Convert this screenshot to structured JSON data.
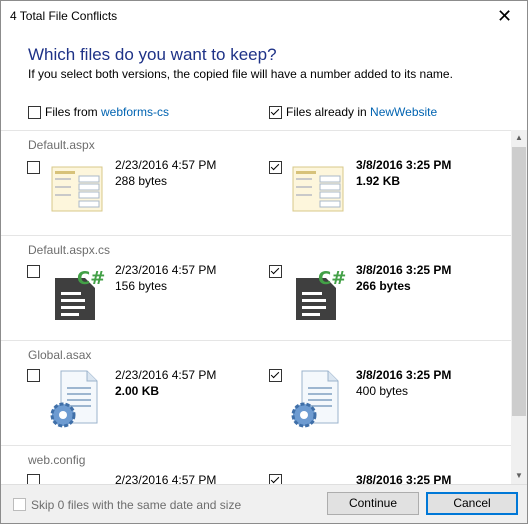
{
  "window": {
    "title": "4 Total File Conflicts",
    "close_glyph": "✕"
  },
  "heading": "Which files do you want to keep?",
  "subtext": "If you select both versions, the copied file will have a number added to its name.",
  "columns": {
    "left": {
      "prefix": "Files from ",
      "link": "webforms-cs",
      "checked": false
    },
    "right": {
      "prefix": "Files already in ",
      "link": "NewWebsite",
      "checked": true
    }
  },
  "files": [
    {
      "name": "Default.aspx",
      "icon": "aspx-form-icon",
      "left": {
        "date": "2/23/2016 4:57 PM",
        "size": "288 bytes",
        "checked": false,
        "bold": false
      },
      "right": {
        "date": "3/8/2016 3:25 PM",
        "size": "1.92 KB",
        "checked": true,
        "bold": true
      }
    },
    {
      "name": "Default.aspx.cs",
      "icon": "csharp-file-icon",
      "left": {
        "date": "2/23/2016 4:57 PM",
        "size": "156 bytes",
        "checked": false,
        "bold": false
      },
      "right": {
        "date": "3/8/2016 3:25 PM",
        "size": "266 bytes",
        "checked": true,
        "bold": true
      }
    },
    {
      "name": "Global.asax",
      "icon": "settings-file-icon",
      "left": {
        "date": "2/23/2016 4:57 PM",
        "size": "2.00 KB",
        "checked": false,
        "bold": true
      },
      "right": {
        "date": "3/8/2016 3:25 PM",
        "size": "400 bytes",
        "checked": true,
        "bold": false
      }
    },
    {
      "name": "web.config",
      "icon": "settings-file-icon",
      "left": {
        "date": "2/23/2016 4:57 PM",
        "size": "",
        "checked": false,
        "bold": false
      },
      "right": {
        "date": "3/8/2016 3:25 PM",
        "size": "",
        "checked": true,
        "bold": true
      }
    }
  ],
  "footer": {
    "skip_label": "Skip 0 files with the same date and size",
    "continue_label": "Continue",
    "cancel_label": "Cancel"
  },
  "colors": {
    "heading": "#1e3287",
    "link": "#0063b1",
    "accent": "#0078d7"
  }
}
